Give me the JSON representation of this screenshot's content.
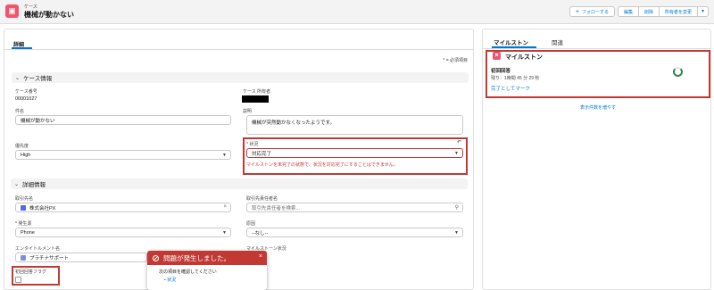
{
  "header": {
    "object_label": "ケース",
    "title": "機械が動かない",
    "follow_label": "フォローする",
    "edit_label": "編集",
    "delete_label": "削除",
    "change_owner_label": "所有者を変更",
    "accent": "#f2536d"
  },
  "main": {
    "tab_label": "詳細",
    "required_note_star": "*",
    "required_note": "= 必須項目",
    "case_info": {
      "section_title": "ケース情報",
      "case_number_label": "ケース番号",
      "case_number": "00001027",
      "owner_label": "ケース 所有者",
      "subject_label": "件名",
      "subject_value": "機械が動かない",
      "description_label": "説明",
      "description_value": "機械が突然動かなくなったようです。",
      "priority_label": "優先度",
      "priority_value": "High",
      "status_label": "状況",
      "status_value": "対応完了",
      "status_error": "マイルストンを未完了の状態で、状況を対応完了にすることはできません。"
    },
    "detail_info": {
      "section_title": "詳細情報",
      "account_label": "取引先名",
      "account_value": "株式会社PX",
      "contact_label": "取引先責任者名",
      "contact_placeholder": "取引先責任者を検索...",
      "origin_label": "発生源",
      "origin_value": "Phone",
      "reason_label": "原因",
      "reason_value": "--なし--",
      "entitlement_label": "エンタイトルメント名",
      "entitlement_value": "プラチナサポート",
      "milestone_status_label": "マイルストーン状況",
      "first_response_label": "初回回答フラグ"
    }
  },
  "error_popup": {
    "title": "問題が発生しました。",
    "message": "次の項目を確認してください",
    "field_link": "状況"
  },
  "side": {
    "tab_milestones": "マイルストン",
    "tab_related": "関連",
    "card_title": "マイルストン",
    "milestone_name": "初回回答",
    "remaining": "残り：1時間 45 分 29 秒",
    "complete_link": "完了としてマーク",
    "show_more": "表示件数を増やす"
  },
  "colors": {
    "error": "#c23934",
    "link": "#0176d3",
    "progress": "#2e844a"
  }
}
